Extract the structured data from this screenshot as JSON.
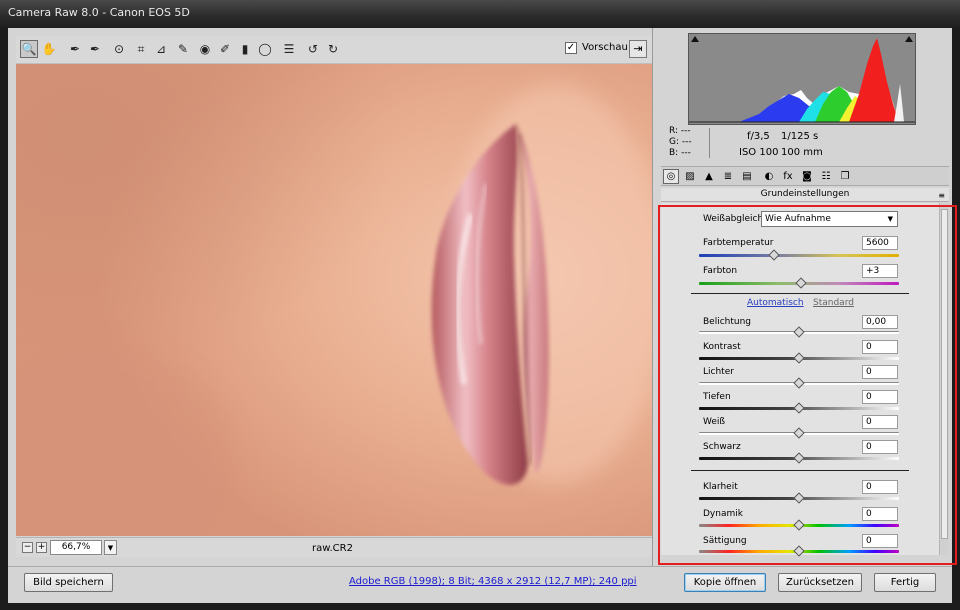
{
  "window": {
    "title": "Camera Raw 8.0 - Canon EOS 5D"
  },
  "toolbar": {
    "tools": [
      {
        "name": "zoom-tool-icon",
        "glyph": "🔍"
      },
      {
        "name": "hand-tool-icon",
        "glyph": "✋"
      },
      {
        "name": "white-balance-tool-icon",
        "glyph": "✒"
      },
      {
        "name": "color-sampler-tool-icon",
        "glyph": "✒"
      },
      {
        "name": "targeted-adjustment-tool-icon",
        "glyph": "⊙"
      },
      {
        "name": "crop-tool-icon",
        "glyph": "⌗"
      },
      {
        "name": "straighten-tool-icon",
        "glyph": "⊿"
      },
      {
        "name": "spot-removal-tool-icon",
        "glyph": "✎"
      },
      {
        "name": "red-eye-removal-tool-icon",
        "glyph": "◉"
      },
      {
        "name": "adjustment-brush-tool-icon",
        "glyph": "✐"
      },
      {
        "name": "graduated-filter-tool-icon",
        "glyph": "▮"
      },
      {
        "name": "radial-filter-tool-icon",
        "glyph": "◯"
      },
      {
        "name": "preferences-icon",
        "glyph": "☰"
      },
      {
        "name": "rotate-left-icon",
        "glyph": "↺"
      },
      {
        "name": "rotate-right-icon",
        "glyph": "↻"
      }
    ],
    "preview_label": "Vorschau",
    "preview_checked": "✓",
    "exit_icon": "⇥"
  },
  "status": {
    "zoom": "66,7%",
    "filename": "raw.CR2",
    "zoom_out": "−",
    "zoom_in": "+"
  },
  "histogram": {
    "rgb_labels": [
      "R:",
      "G:",
      "B:"
    ],
    "rgb_values": [
      "---",
      "---",
      "---"
    ],
    "aperture": "f/3,5",
    "shutter": "1/125 s",
    "iso": "ISO 100",
    "focal": "100 mm"
  },
  "panel_tabs": [
    "◎",
    "▨",
    "▲",
    "≣",
    "▤",
    "◐",
    "fx",
    "◙",
    "☷",
    "❐"
  ],
  "panel": {
    "title": "Grundeinstellungen",
    "menu_icon": "≡",
    "wb_label": "Weißabgleich:",
    "wb_value": "Wie Aufnahme",
    "temp_label": "Farbtemperatur",
    "temp_value": "5600",
    "tint_label": "Farbton",
    "tint_value": "+3",
    "auto_label": "Automatisch",
    "default_label": "Standard",
    "sliders": [
      {
        "label": "Belichtung",
        "value": "0,00"
      },
      {
        "label": "Kontrast",
        "value": "0"
      },
      {
        "label": "Lichter",
        "value": "0"
      },
      {
        "label": "Tiefen",
        "value": "0"
      },
      {
        "label": "Weiß",
        "value": "0"
      },
      {
        "label": "Schwarz",
        "value": "0"
      }
    ],
    "sliders2": [
      {
        "label": "Klarheit",
        "value": "0"
      },
      {
        "label": "Dynamik",
        "value": "0"
      },
      {
        "label": "Sättigung",
        "value": "0"
      }
    ]
  },
  "bottom": {
    "save_label": "Bild speichern",
    "info_link": "Adobe RGB (1998); 8 Bit; 4368 x 2912 (12,7 MP); 240 ppi",
    "open_label": "Kopie öffnen",
    "reset_label": "Zurücksetzen",
    "done_label": "Fertig"
  },
  "colors": {
    "highlight_frame": "#e31e1e",
    "accent": "#2a40c0"
  }
}
